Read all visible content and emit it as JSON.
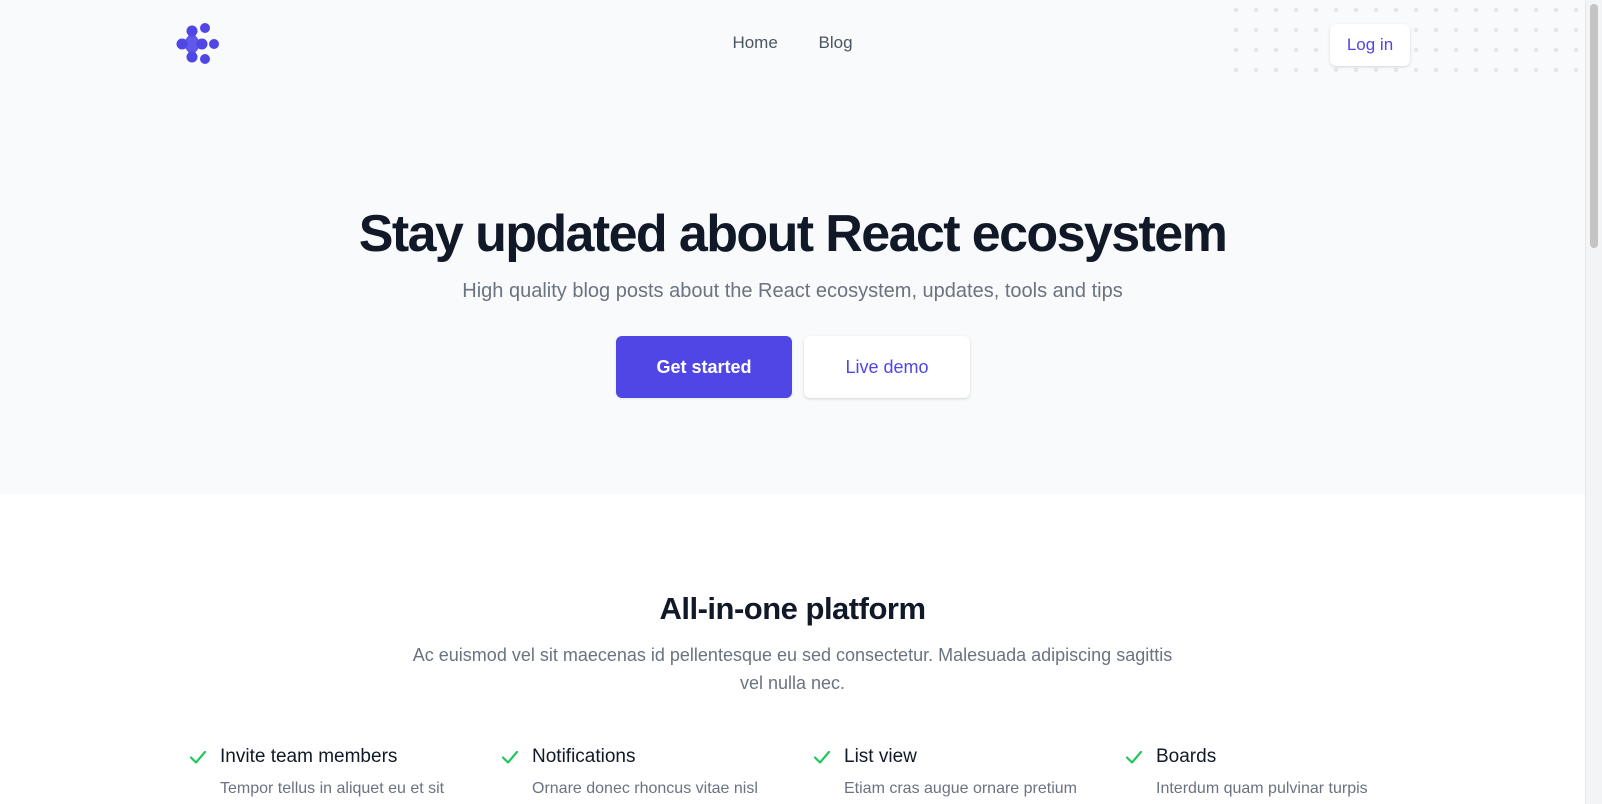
{
  "colors": {
    "accent": "#4f46e5",
    "heading": "#111827",
    "muted": "#6b7280",
    "check": "#22c55e",
    "hero_bg": "#f9fafb"
  },
  "header": {
    "logo_icon": "dots-chevron-logo-icon",
    "nav": [
      {
        "label": "Home"
      },
      {
        "label": "Blog"
      }
    ],
    "login_label": "Log in"
  },
  "hero": {
    "title": "Stay updated about React ecosystem",
    "subtitle": "High quality blog posts about the React ecosystem, updates, tools and tips",
    "primary_cta": "Get started",
    "secondary_cta": "Live demo"
  },
  "features": {
    "title": "All-in-one platform",
    "subtitle": "Ac euismod vel sit maecenas id pellentesque eu sed consectetur. Malesuada adipiscing sagittis vel nulla nec.",
    "check_icon": "check-icon",
    "items": [
      {
        "title": "Invite team members",
        "description": "Tempor tellus in aliquet eu et sit"
      },
      {
        "title": "Notifications",
        "description": "Ornare donec rhoncus vitae nisl"
      },
      {
        "title": "List view",
        "description": "Etiam cras augue ornare pretium"
      },
      {
        "title": "Boards",
        "description": "Interdum quam pulvinar turpis"
      }
    ]
  }
}
